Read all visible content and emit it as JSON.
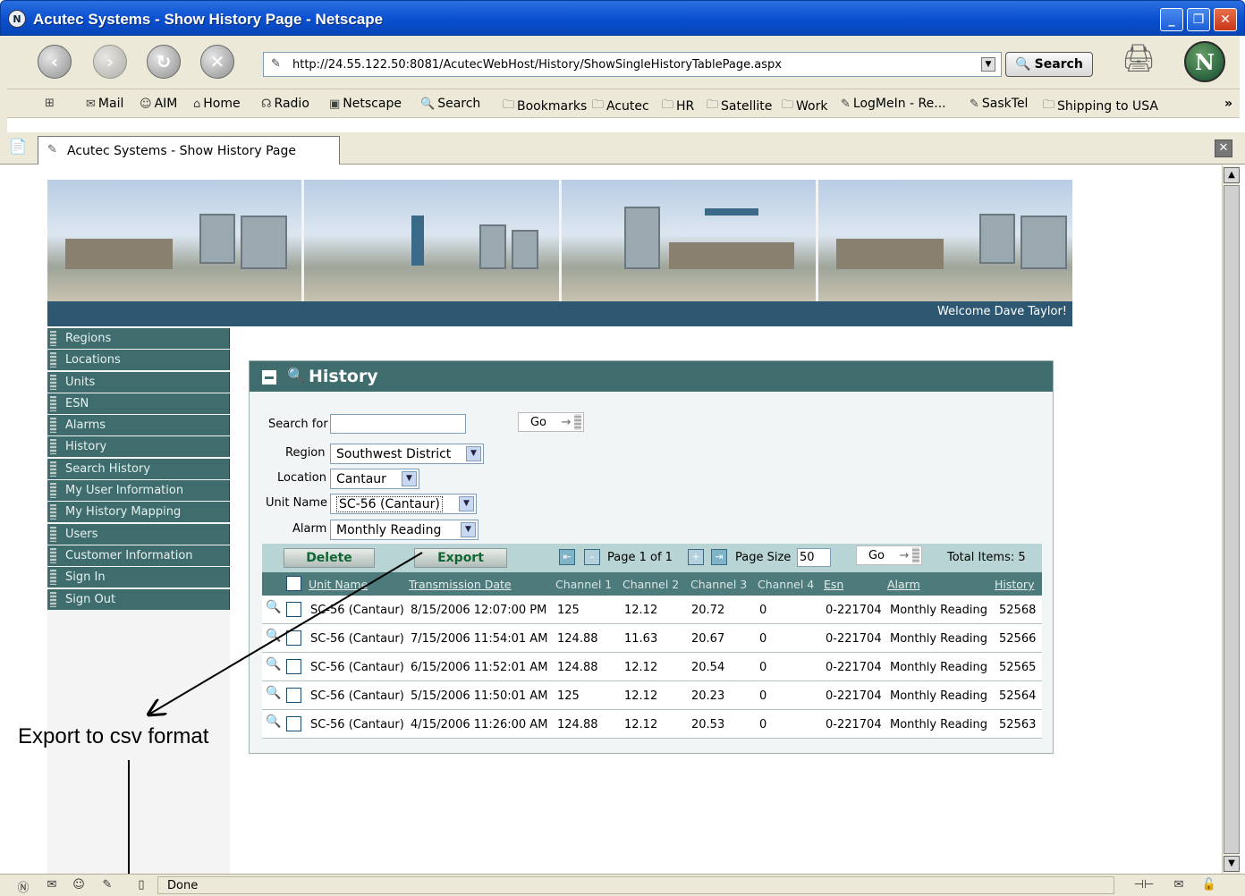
{
  "window": {
    "title": "Acutec Systems - Show History Page - Netscape",
    "app_icon": "netscape-icon"
  },
  "navbar": {
    "url": "http://24.55.122.50:8081/AcutecWebHost/History/ShowSingleHistoryTablePage.aspx",
    "search_label": "Search"
  },
  "personal_toolbar": {
    "items": [
      "Mail",
      "AIM",
      "Home",
      "Radio",
      "Netscape",
      "Search",
      "Bookmarks",
      "Acutec",
      "HR",
      "Satellite",
      "Work",
      "LogMeIn - Re...",
      "SaskTel",
      "Shipping to USA"
    ],
    "more": "»"
  },
  "tab": {
    "title": "Acutec Systems - Show History Page"
  },
  "header": {
    "welcome": "Welcome Dave Taylor!"
  },
  "sidebar": {
    "items": [
      "Regions",
      "Locations",
      "Units",
      "ESN",
      "Alarms",
      "History",
      "Search History",
      "My User Information",
      "My History Mapping",
      "Users",
      "Customer Information",
      "Sign In",
      "Sign Out"
    ]
  },
  "history": {
    "title": "History",
    "search_label": "Search for",
    "search_value": "",
    "go_label": "Go",
    "region_label": "Region",
    "region_value": "Southwest District",
    "location_label": "Location",
    "location_value": "Cantaur",
    "unit_label": "Unit Name",
    "unit_value": "SC-56 (Cantaur)",
    "alarm_label": "Alarm",
    "alarm_value": "Monthly Reading"
  },
  "grid": {
    "delete_label": "Delete",
    "export_label": "Export",
    "page_text": "Page 1 of 1",
    "page_size_label": "Page Size",
    "page_size_value": "50",
    "go_label": "Go",
    "total_items": "Total Items: 5",
    "columns": [
      "Unit Name",
      "Transmission Date",
      "Channel 1",
      "Channel 2",
      "Channel 3",
      "Channel 4",
      "Esn",
      "Alarm",
      "History"
    ],
    "rows": [
      {
        "unit": "SC-56 (Cantaur)",
        "date": "8/15/2006 12:07:00 PM",
        "ch1": "125",
        "ch2": "12.12",
        "ch3": "20.72",
        "ch4": "0",
        "esn": "0-221704",
        "alarm": "Monthly Reading",
        "history": "52568"
      },
      {
        "unit": "SC-56 (Cantaur)",
        "date": "7/15/2006 11:54:01 AM",
        "ch1": "124.88",
        "ch2": "11.63",
        "ch3": "20.67",
        "ch4": "0",
        "esn": "0-221704",
        "alarm": "Monthly Reading",
        "history": "52566"
      },
      {
        "unit": "SC-56 (Cantaur)",
        "date": "6/15/2006 11:52:01 AM",
        "ch1": "124.88",
        "ch2": "12.12",
        "ch3": "20.54",
        "ch4": "0",
        "esn": "0-221704",
        "alarm": "Monthly Reading",
        "history": "52565"
      },
      {
        "unit": "SC-56 (Cantaur)",
        "date": "5/15/2006 11:50:01 AM",
        "ch1": "125",
        "ch2": "12.12",
        "ch3": "20.23",
        "ch4": "0",
        "esn": "0-221704",
        "alarm": "Monthly Reading",
        "history": "52564"
      },
      {
        "unit": "SC-56 (Cantaur)",
        "date": "4/15/2006 11:26:00 AM",
        "ch1": "124.88",
        "ch2": "12.12",
        "ch3": "20.53",
        "ch4": "0",
        "esn": "0-221704",
        "alarm": "Monthly Reading",
        "history": "52563"
      }
    ]
  },
  "annotation": {
    "text": "Export to csv format"
  },
  "status": {
    "text": "Done"
  },
  "colors": {
    "menu": "#3f6d6e",
    "header_bar": "#2e5872",
    "grid_toolbar": "#b8d4d4"
  }
}
